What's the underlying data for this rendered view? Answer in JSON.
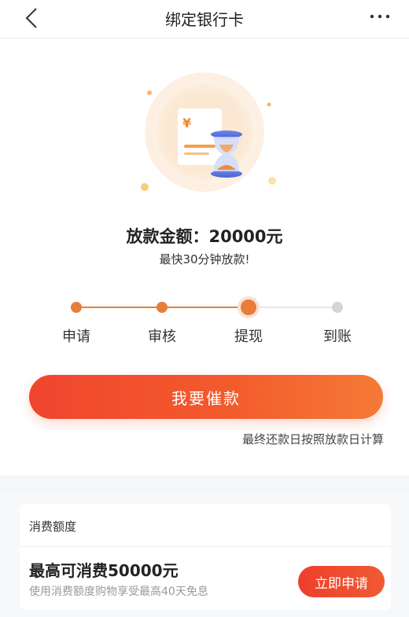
{
  "nav": {
    "title": "绑定银行卡",
    "back_icon": "chevron-left-icon",
    "more_icon": "ellipsis-icon"
  },
  "hero": {
    "illustration": "document-hourglass-icon",
    "currency_symbol": "¥"
  },
  "loan": {
    "amount_text": "放款金额：20000元",
    "speed_text": "最快30分钟放款!"
  },
  "steps": {
    "items": [
      {
        "label": "申请",
        "status": "done"
      },
      {
        "label": "审核",
        "status": "done"
      },
      {
        "label": "提现",
        "status": "current"
      },
      {
        "label": "到账",
        "status": "pending"
      }
    ],
    "active_color": "#e67e3a",
    "inactive_color": "#d5d5d5"
  },
  "cta": {
    "label": "我要催款",
    "note": "最终还款日按照放款日计算"
  },
  "card": {
    "title": "消费额度",
    "main_text": "最高可消费50000元",
    "sub_text": "使用消费额度购物享受最高40天免息",
    "button_label": "立即申请"
  },
  "colors": {
    "accent": "#f0452e",
    "accent_end": "#f57a36"
  }
}
